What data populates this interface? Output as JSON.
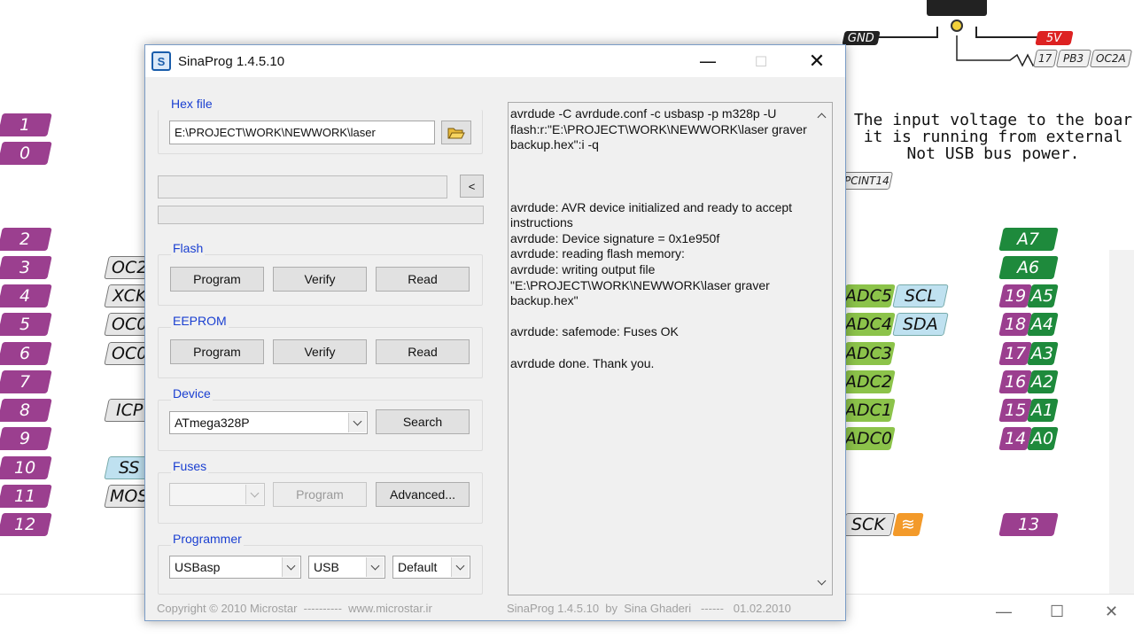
{
  "background": {
    "left_pins": [
      "1",
      "0",
      "2",
      "3",
      "4",
      "5",
      "6",
      "7",
      "8",
      "9",
      "10",
      "11",
      "12"
    ],
    "left_labels": [
      "OC2",
      "XCK",
      "OC0",
      "OC0",
      "ICP",
      "SS",
      "MOS"
    ],
    "right_labels_a": [
      "ADC5",
      "ADC4",
      "ADC3",
      "ADC2",
      "ADC1",
      "ADC0"
    ],
    "right_labels_b": [
      "SCL",
      "SDA"
    ],
    "right_pin_nums": [
      "19",
      "18",
      "17",
      "16",
      "15",
      "14"
    ],
    "right_pin_a": [
      "A5",
      "A4",
      "A3",
      "A2",
      "A1",
      "A0"
    ],
    "a7": "A7",
    "a6": "A6",
    "sck": "SCK",
    "pin13": "13",
    "gnd": "GND",
    "v5": "5V",
    "top_pin_num": "17",
    "top_pb3": "PB3",
    "top_oc2a": "OC2A",
    "pcint": "PCINT14",
    "note": "The input voltage to the boar\nit is running from external\nNot USB bus power."
  },
  "window": {
    "title": "SinaProg 1.4.5.10",
    "hex_file": {
      "label": "Hex file",
      "path": "E:\\PROJECT\\WORK\\NEWWORK\\laser"
    },
    "small_button": "<",
    "flash": {
      "label": "Flash",
      "program": "Program",
      "verify": "Verify",
      "read": "Read"
    },
    "eeprom": {
      "label": "EEPROM",
      "program": "Program",
      "verify": "Verify",
      "read": "Read"
    },
    "device": {
      "label": "Device",
      "selected": "ATmega328P",
      "search": "Search"
    },
    "fuses": {
      "label": "Fuses",
      "selected": "",
      "program": "Program",
      "advanced": "Advanced..."
    },
    "programmer": {
      "label": "Programmer",
      "programmer": "USBasp",
      "port": "USB",
      "speed": "Default"
    },
    "log_lines": [
      "avrdude -C avrdude.conf -c usbasp -p m328p -U flash:r:\"E:\\PROJECT\\WORK\\NEWWORK\\laser graver backup.hex\":i -q",
      "",
      "",
      "",
      "avrdude: AVR device initialized and ready to accept instructions",
      "avrdude: Device signature = 0x1e950f",
      "avrdude: reading flash memory:",
      "avrdude: writing output file \"E:\\PROJECT\\WORK\\NEWWORK\\laser graver backup.hex\"",
      "",
      "avrdude: safemode: Fuses OK",
      "",
      "avrdude done.  Thank you."
    ],
    "footer_left": "Copyright © 2010 Microstar  ----------  www.microstar.ir",
    "footer_right": "SinaProg 1.4.5.10  by  Sina Ghaderi   ------   01.02.2010"
  }
}
